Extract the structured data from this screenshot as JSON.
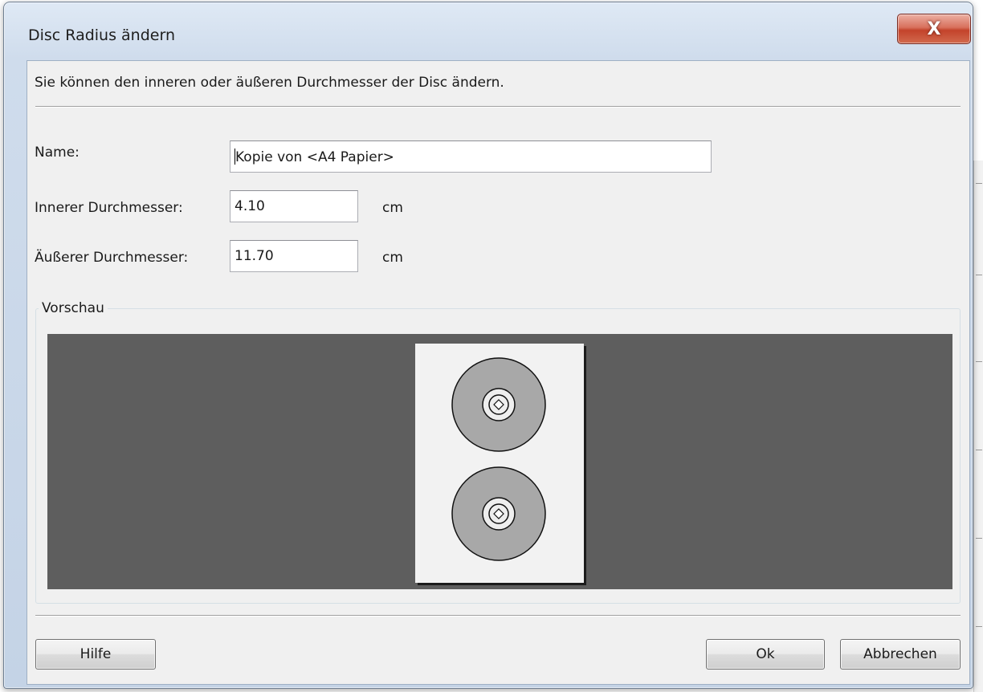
{
  "window": {
    "title": "Disc Radius ändern",
    "close_glyph": "X"
  },
  "intro_text": "Sie können den inneren oder äußeren Durchmesser der Disc ändern.",
  "form": {
    "name_label": "Name:",
    "name_value": "Kopie von <A4 Papier>",
    "inner_label": "Innerer Durchmesser:",
    "inner_value": "4.10",
    "inner_unit": "cm",
    "outer_label": "Äußerer Durchmesser:",
    "outer_value": "11.70",
    "outer_unit": "cm"
  },
  "preview": {
    "group_label": "Vorschau",
    "disc_count": 2,
    "background_color": "#5e5e5e",
    "disc_color": "#a8a8a8",
    "sheet_color": "#f2f2f2"
  },
  "buttons": {
    "help": "Hilfe",
    "ok": "Ok",
    "cancel": "Abbrechen"
  }
}
